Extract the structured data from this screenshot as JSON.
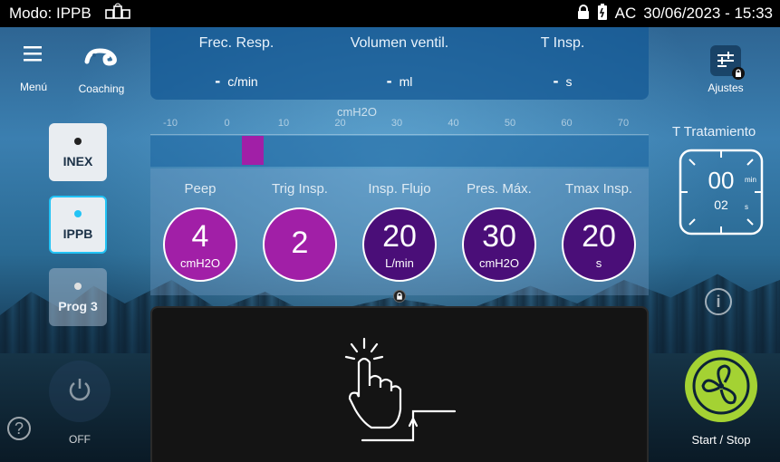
{
  "status": {
    "mode_label": "Modo: IPPB",
    "network_icon": "network-icon",
    "power_source": "AC",
    "datetime": "30/06/2023 - 15:33"
  },
  "top_bar": {
    "menu_label": "Menú",
    "coaching_label": "Coaching",
    "metrics": [
      {
        "label": "Frec. Resp.",
        "value": "-",
        "unit": "c/min"
      },
      {
        "label": "Volumen ventil.",
        "value": "-",
        "unit": "ml"
      },
      {
        "label": "T Insp.",
        "value": "-",
        "unit": "s"
      }
    ],
    "settings_label": "Ajustes"
  },
  "modes": [
    {
      "label": "INEX",
      "dot_color": "#222222",
      "bg": "#e9edf1",
      "state": "normal"
    },
    {
      "label": "IPPB",
      "dot_color": "#22c3f5",
      "bg": "#e9edf1",
      "state": "selected"
    },
    {
      "label": "Prog 3",
      "dot_color": "#e0e0e0",
      "bg": "#9fb1c2",
      "state": "disabled"
    }
  ],
  "off_label": "OFF",
  "pressure_scale": {
    "unit": "cmH2O",
    "ticks": [
      "-10",
      "0",
      "10",
      "20",
      "30",
      "40",
      "50",
      "60",
      "70"
    ],
    "range": [
      -10,
      70
    ],
    "current": 3
  },
  "parameters": [
    {
      "label": "Peep",
      "value": "4",
      "unit": "cmH2O",
      "color": "#a11fa7"
    },
    {
      "label": "Trig Insp.",
      "value": "2",
      "unit": "",
      "color": "#a11fa7"
    },
    {
      "label": "Insp. Flujo",
      "value": "20",
      "unit": "L/min",
      "color": "#4a0e78"
    },
    {
      "label": "Pres. Máx.",
      "value": "30",
      "unit": "cmH2O",
      "color": "#4a0e78"
    },
    {
      "label": "Tmax Insp.",
      "value": "20",
      "unit": "s",
      "color": "#4a0e78"
    }
  ],
  "treatment": {
    "label": "T Tratamiento",
    "minutes": "00",
    "minutes_unit": "min",
    "seconds": "02",
    "seconds_unit": "s"
  },
  "start_stop_label": "Start / Stop",
  "colors": {
    "accent_green": "#a4d233",
    "lock_bg": "#1a1a1a"
  }
}
